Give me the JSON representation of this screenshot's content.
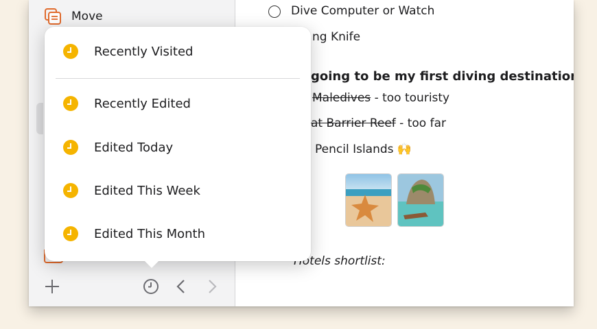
{
  "sidebar": {
    "move_label": "Move"
  },
  "history_menu": {
    "items": [
      {
        "label": "Recently Visited"
      },
      {
        "label": "Recently Edited"
      },
      {
        "label": "Edited Today"
      },
      {
        "label": "Edited This Week"
      },
      {
        "label": "Edited This Month"
      }
    ]
  },
  "note": {
    "todo_item": "Dive Computer or Watch",
    "knife_line": "ng Knife",
    "heading": "going to be my first diving destination?",
    "option1_struck": "Maledives",
    "option1_note": " - too touristy",
    "option2_struck": "at Barrier Reef",
    "option2_note": " - too far",
    "option3": "Pencil Islands 🙌",
    "hotels_label": "Hotels shortlist:"
  },
  "colors": {
    "accent_orange": "#e06a2c",
    "clock_yellow": "#f5b400",
    "background": "#f8f1e5"
  },
  "icons": {
    "move": "move-notes-icon",
    "history": "clock-icon",
    "add": "plus-icon",
    "back": "chevron-left-icon",
    "forward": "chevron-right-icon",
    "todo": "checkbox-circle-icon"
  }
}
